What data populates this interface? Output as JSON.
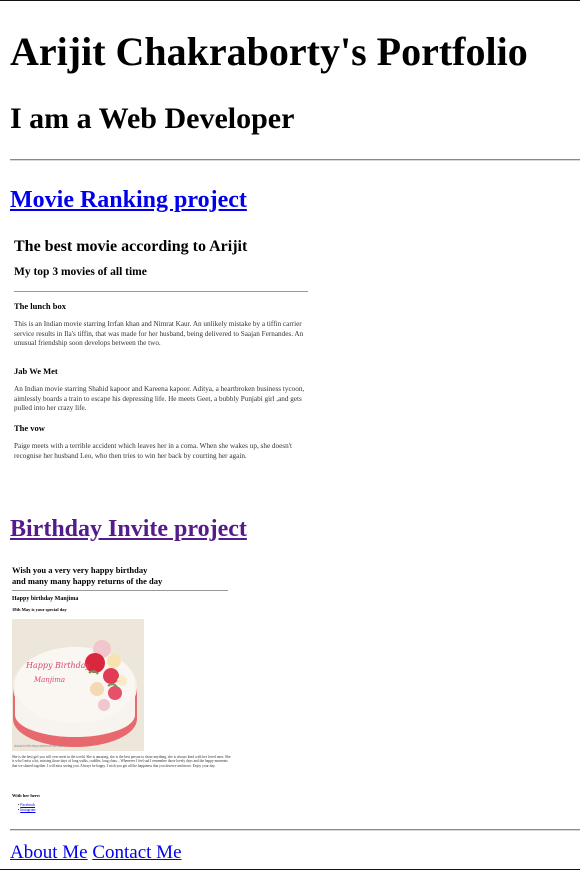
{
  "header": {
    "title": "Arijit Chakraborty's Portfolio",
    "subtitle": "I am a Web Developer"
  },
  "projects": [
    {
      "link_text": "Movie Ranking project",
      "preview": {
        "heading": "The best movie according to Arijit",
        "subheading": "My top 3 movies of all time",
        "movies": [
          {
            "title": "The lunch box",
            "description": "This is an Indian movie starring Irrfan khan and Nimrat Kaur. An unlikely mistake by a tiffin carrier service results in Ila's tiffin, that was made for her husband, being delivered to Saajan Fernandes. An unusual friendship soon develops between the two."
          },
          {
            "title": "Jab We Met",
            "description": "An Indian movie starring Shahid kapoor and Kareena kapoor. Aditya, a heartbroken business tycoon, aimlessly boards a train to escape his depressing life. He meets Geet, a bubbly Punjabi girl ,and gets pulled into her crazy life."
          },
          {
            "title": "The vow",
            "description": "Paige meets with a terrible accident which leaves her in a coma. When she wakes up, she doesn't recognise her husband Leo, who then tries to win her back by courting her again."
          }
        ]
      }
    },
    {
      "link_text": "Birthday Invite project",
      "preview": {
        "heading_line1": "Wish you a very very happy birthday",
        "heading_line2": "and many many happy returns of the day",
        "subheading": "Happy birthday Manjima",
        "date_line": "18th May is your special day",
        "cake_text_1": "Happy Birthday",
        "cake_text_2": "Manjima",
        "cake_watermark": "www.birthdaycakename.com",
        "paragraph": "She is the best girl you will ever meet in the world. She is amazing, she is the best person to share anything, she is always kind with her loved ones. She is who I miss a lot, missing those days of long walks, cuddles, long chats... Whenever I feel sad I remember those lovely days and the happy moments that we shared together. I will miss seeing you. Always be happy. I wish you get all the happiness that you deserve and more. Enjoy your day.",
        "with_line": "With her here:",
        "links": [
          "Facebook",
          "Instagram"
        ]
      }
    }
  ],
  "footer": {
    "about": "About Me",
    "contact": "Contact Me"
  },
  "colors": {
    "link_unvisited": "#0000ee",
    "link_visited": "#551a8b"
  }
}
